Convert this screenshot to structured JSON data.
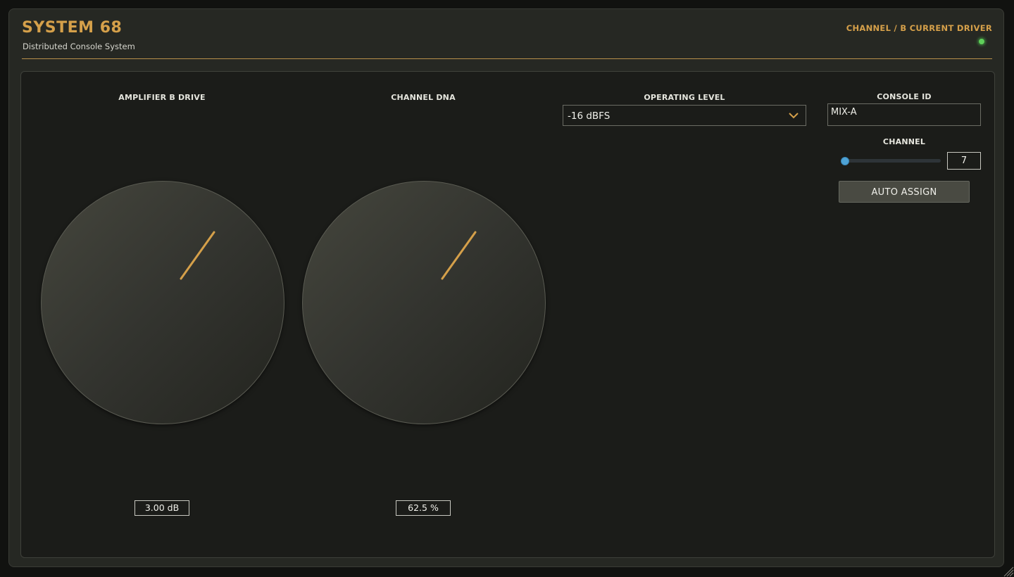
{
  "header": {
    "title": "SYSTEM 68",
    "subtitle": "Distributed Console System",
    "channel_label": "CHANNEL / B CURRENT DRIVER",
    "status_led_color": "#5fcf5a"
  },
  "controls": {
    "amplifier_drive": {
      "label": "AMPLIFIER B DRIVE",
      "readout": "3.00 dB",
      "indicator_color": "#d5a04a"
    },
    "channel_dna": {
      "label": "CHANNEL DNA",
      "readout": "62.5 %",
      "indicator_color": "#d5a04a"
    },
    "operating_level": {
      "label": "OPERATING LEVEL",
      "selected": "-16 dBFS",
      "icon": "chevron-down-icon"
    },
    "console_id": {
      "label": "CONSOLE ID",
      "value": "MIX-A"
    },
    "channel": {
      "label": "CHANNEL",
      "value": "7",
      "slider_fraction": 0.0,
      "thumb_color": "#4ea3d6"
    },
    "auto_assign": {
      "label": "AUTO ASSIGN"
    }
  },
  "colors": {
    "accent": "#d5a04a",
    "panel_bg": "#1b1c19",
    "frame_bg": "#262823"
  }
}
